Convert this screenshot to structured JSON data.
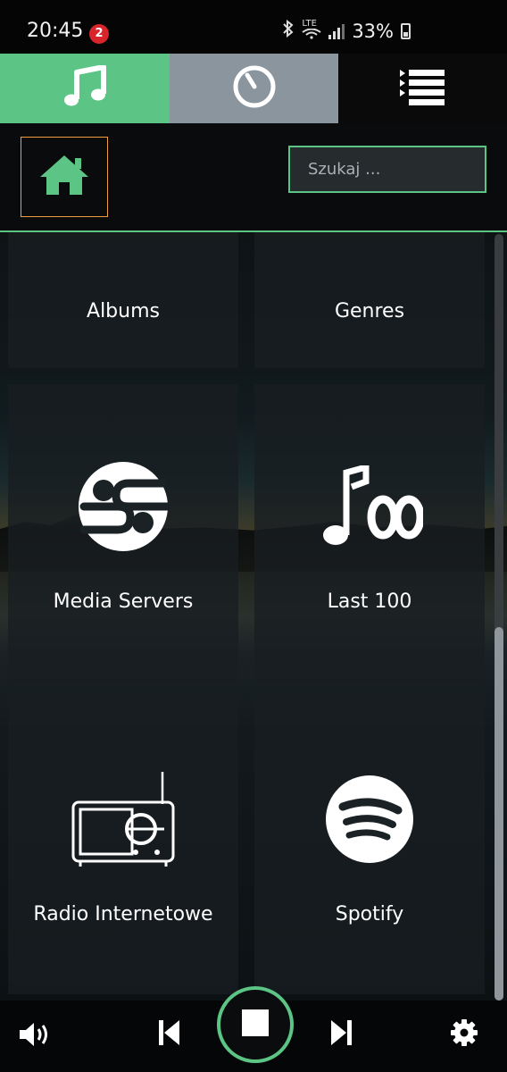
{
  "status_bar": {
    "time": "20:45",
    "notification_badge": "2",
    "network": "LTE",
    "battery": "33%",
    "icons": [
      "bluetooth-icon",
      "wifi-icon",
      "signal-icon",
      "battery-icon"
    ]
  },
  "top_tabs": [
    {
      "name": "library",
      "icon": "music-note-icon",
      "active": true,
      "color": "#5cc585"
    },
    {
      "name": "now-playing",
      "icon": "dial-icon",
      "active": false,
      "color": "#8a959d"
    },
    {
      "name": "queue",
      "icon": "list-icon",
      "active": false,
      "color": "#0a0a0a"
    }
  ],
  "header": {
    "home_icon": "home-icon",
    "search_placeholder": "Szukaj ..."
  },
  "tiles": [
    {
      "label": "Albums",
      "icon": null
    },
    {
      "label": "Genres",
      "icon": null
    },
    {
      "label": "Media Servers",
      "icon": "media-servers-icon"
    },
    {
      "label": "Last 100",
      "icon": "last-100-icon"
    },
    {
      "label": "Radio Internetowe",
      "icon": "radio-icon"
    },
    {
      "label": "Spotify",
      "icon": "spotify-icon"
    }
  ],
  "footer": {
    "volume_icon": "volume-icon",
    "prev_icon": "previous-icon",
    "stop_icon": "stop-icon",
    "next_icon": "next-icon",
    "settings_icon": "gear-icon"
  },
  "colors": {
    "accent": "#5cc585",
    "home_border": "#f0a040",
    "tab_secondary": "#8a959d"
  }
}
